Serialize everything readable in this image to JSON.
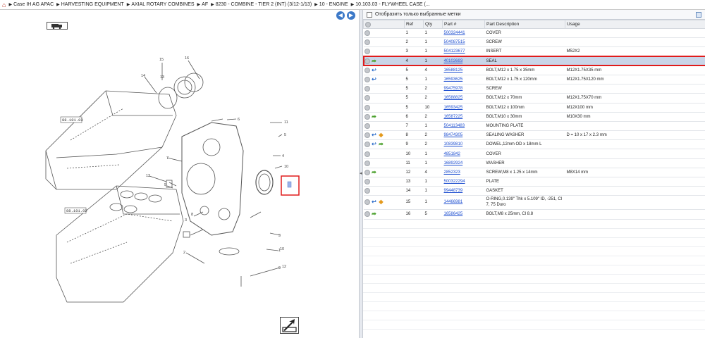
{
  "breadcrumb": {
    "items": [
      "Case IH AG APAC",
      "HARVESTING EQUIPMENT",
      "AXIAL ROTARY COMBINES",
      "AF",
      "8230 - COMBINE - TIER 2 (INT) (3/12-1/13)",
      "10 - ENGINE",
      "10.103.03 - FLYWHEEL CASE (..."
    ]
  },
  "diagram": {
    "callouts": [
      "15",
      "16",
      "14",
      "13",
      "6",
      "11",
      "5",
      "4",
      "10",
      "12",
      "7",
      "8",
      "2",
      "3",
      "1",
      "9",
      "5",
      "3",
      "10",
      "12"
    ],
    "engine_labels": [
      "88.101.03",
      "88.101.02"
    ]
  },
  "filter": {
    "label": "Отобразить только выбранные метки",
    "checked": false
  },
  "table": {
    "headers": [
      "Ref",
      "Qty",
      "Part #",
      "Part Description",
      "Usage"
    ],
    "rows": [
      {
        "icons": [],
        "ref": "1",
        "qty": "1",
        "part": "500324441",
        "desc": "COVER",
        "usage": "",
        "selected": false
      },
      {
        "icons": [],
        "ref": "2",
        "qty": "1",
        "part": "504087515",
        "desc": "SCREW",
        "usage": "",
        "selected": false
      },
      {
        "icons": [],
        "ref": "3",
        "qty": "1",
        "part": "504123677",
        "desc": "INSERT",
        "usage": "M52X2",
        "selected": false
      },
      {
        "icons": [
          "green"
        ],
        "ref": "4",
        "qty": "1",
        "part": "40102693",
        "desc": "SEAL",
        "usage": "",
        "selected": true
      },
      {
        "icons": [
          "blue"
        ],
        "ref": "5",
        "qty": "4",
        "part": "16588125",
        "desc": "BOLT,M12 x 1.75 x 35mm",
        "usage": "M12X1.75X35 mm",
        "selected": false
      },
      {
        "icons": [
          "blue"
        ],
        "ref": "5",
        "qty": "1",
        "part": "16593625",
        "desc": "BOLT,M12 x 1.75 x 120mm",
        "usage": "M12X1.75X120 mm",
        "selected": false
      },
      {
        "icons": [],
        "ref": "5",
        "qty": "2",
        "part": "99475978",
        "desc": "SCREW",
        "usage": "",
        "selected": false
      },
      {
        "icons": [],
        "ref": "5",
        "qty": "2",
        "part": "16588825",
        "desc": "BOLT,M12 x 70mm",
        "usage": "M12X1.75X70 mm",
        "selected": false
      },
      {
        "icons": [],
        "ref": "5",
        "qty": "10",
        "part": "16593425",
        "desc": "BOLT,M12 x 100mm",
        "usage": "M12X100 mm",
        "selected": false
      },
      {
        "icons": [
          "green"
        ],
        "ref": "6",
        "qty": "2",
        "part": "16587225",
        "desc": "BOLT,M10 x 30mm",
        "usage": "M10X30 mm",
        "selected": false
      },
      {
        "icons": [],
        "ref": "7",
        "qty": "1",
        "part": "504113483",
        "desc": "MOUNTING PLATE",
        "usage": "",
        "selected": false
      },
      {
        "icons": [
          "blue",
          "orange"
        ],
        "ref": "8",
        "qty": "2",
        "part": "98474305",
        "desc": "SEALING WASHER",
        "usage": "D = 10 x 17 x 2.3 mm",
        "selected": false
      },
      {
        "icons": [
          "blue",
          "green"
        ],
        "ref": "9",
        "qty": "2",
        "part": "10839810",
        "desc": "DOWEL,12mm OD x 18mm L",
        "usage": "",
        "selected": false
      },
      {
        "icons": [],
        "ref": "10",
        "qty": "1",
        "part": "4851842",
        "desc": "COVER",
        "usage": "",
        "selected": false
      },
      {
        "icons": [],
        "ref": "11",
        "qty": "1",
        "part": "16892924",
        "desc": "WASHER",
        "usage": "",
        "selected": false
      },
      {
        "icons": [
          "green"
        ],
        "ref": "12",
        "qty": "4",
        "part": "2852323",
        "desc": "SCREW,M8 x 1.25  x 14mm",
        "usage": "M8X14 mm",
        "selected": false
      },
      {
        "icons": [],
        "ref": "13",
        "qty": "1",
        "part": "500322294",
        "desc": "PLATE",
        "usage": "",
        "selected": false
      },
      {
        "icons": [],
        "ref": "14",
        "qty": "1",
        "part": "99448739",
        "desc": "GASKET",
        "usage": "",
        "selected": false
      },
      {
        "icons": [
          "blue",
          "orange"
        ],
        "ref": "15",
        "qty": "1",
        "part": "14466981",
        "desc": "O-RING,0.139\" Thk x 5.109\" ID, -251, Cl 7, 75 Duro",
        "usage": "",
        "selected": false
      },
      {
        "icons": [
          "green"
        ],
        "ref": "16",
        "qty": "5",
        "part": "16586425",
        "desc": "BOLT,M8 x 25mm, Cl 8.8",
        "usage": "",
        "selected": false
      }
    ]
  },
  "colors": {
    "link": "#1e4fd0",
    "selection_border": "#e01b1b",
    "selected_row": "#c9d5e8"
  }
}
